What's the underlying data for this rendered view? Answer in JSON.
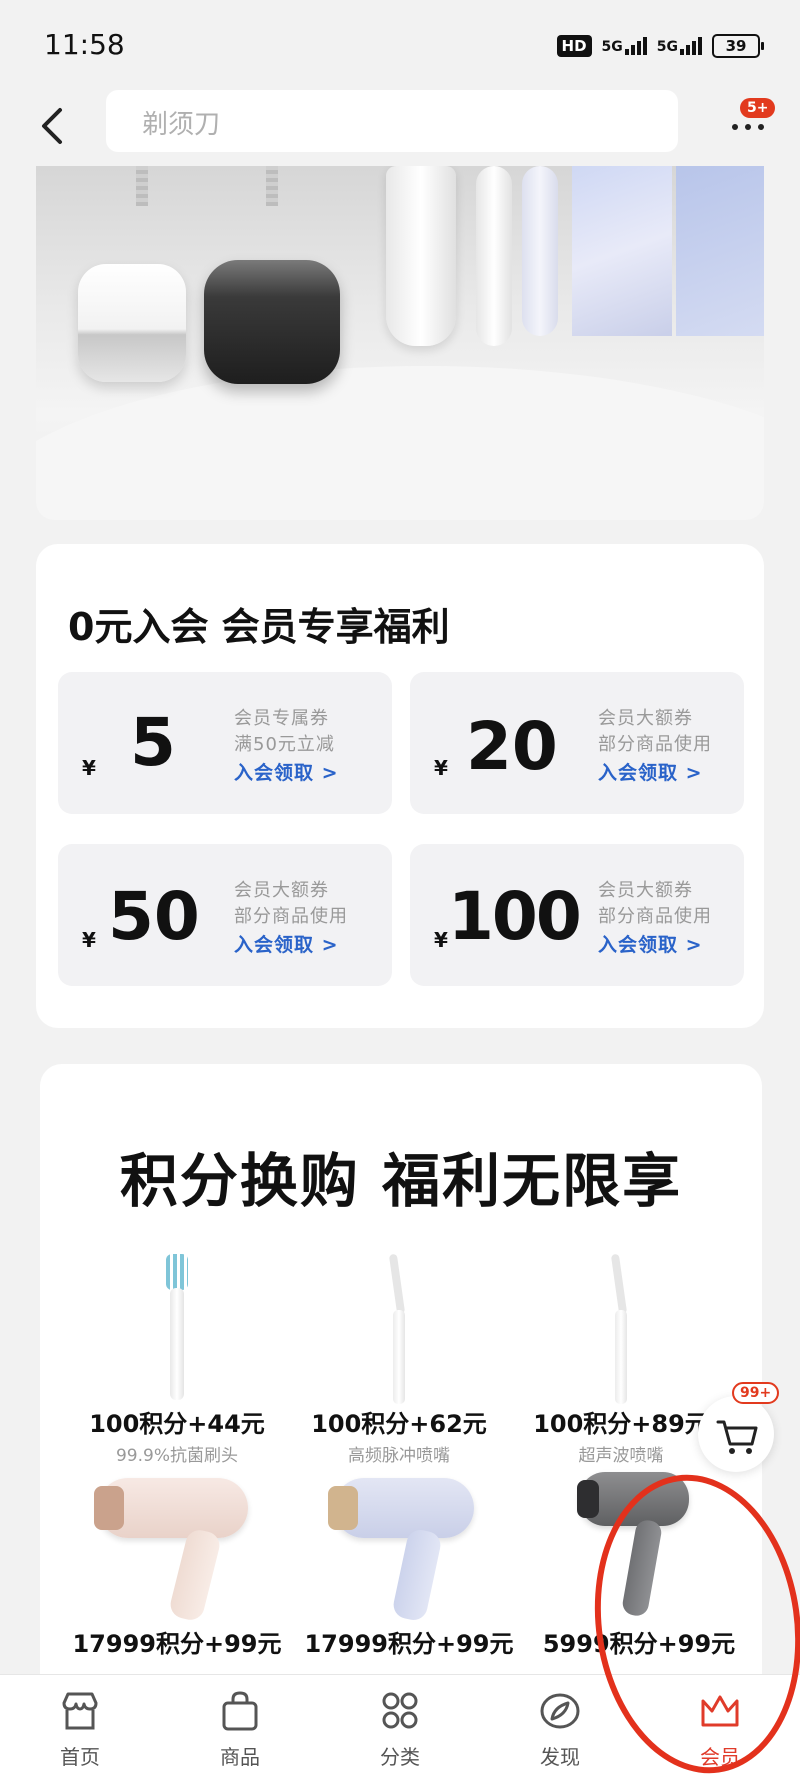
{
  "status": {
    "time": "11:58",
    "hd": "HD",
    "sim1": "5G",
    "sim2": "5G",
    "battery": "39"
  },
  "header": {
    "search_placeholder": "剃须刀",
    "more_badge": "5+"
  },
  "member": {
    "title": "0元入会 会员专享福利",
    "coupons": [
      {
        "yen": "¥",
        "amount": "5",
        "line1": "会员专属券",
        "line2": "满50元立减",
        "link": "入会领取 >"
      },
      {
        "yen": "¥",
        "amount": "20",
        "line1": "会员大额券",
        "line2": "部分商品使用",
        "link": "入会领取 >"
      },
      {
        "yen": "¥",
        "amount": "50",
        "line1": "会员大额券",
        "line2": "部分商品使用",
        "link": "入会领取 >"
      },
      {
        "yen": "¥",
        "amount": "100",
        "line1": "会员大额券",
        "line2": "部分商品使用",
        "link": "入会领取 >"
      }
    ]
  },
  "points": {
    "title": "积分换购 福利无限享",
    "items": [
      {
        "price": "100积分+44元",
        "desc": "99.9%抗菌刷头"
      },
      {
        "price": "100积分+62元",
        "desc": "高频脉冲喷嘴"
      },
      {
        "price": "100积分+89元",
        "desc": "超声波喷嘴"
      },
      {
        "price": "17999积分+99元",
        "desc": ""
      },
      {
        "price": "17999积分+99元",
        "desc": ""
      },
      {
        "price": "5999积分+99元",
        "desc": ""
      }
    ]
  },
  "cart": {
    "badge": "99+"
  },
  "tabs": [
    {
      "label": "首页",
      "icon": "store-icon"
    },
    {
      "label": "商品",
      "icon": "bag-icon"
    },
    {
      "label": "分类",
      "icon": "grid-icon"
    },
    {
      "label": "发现",
      "icon": "compass-icon"
    },
    {
      "label": "会员",
      "icon": "crown-icon",
      "active": true
    }
  ],
  "colors": {
    "accent": "#e03b2a",
    "link": "#2a63c9",
    "annotation": "#e3311c"
  }
}
